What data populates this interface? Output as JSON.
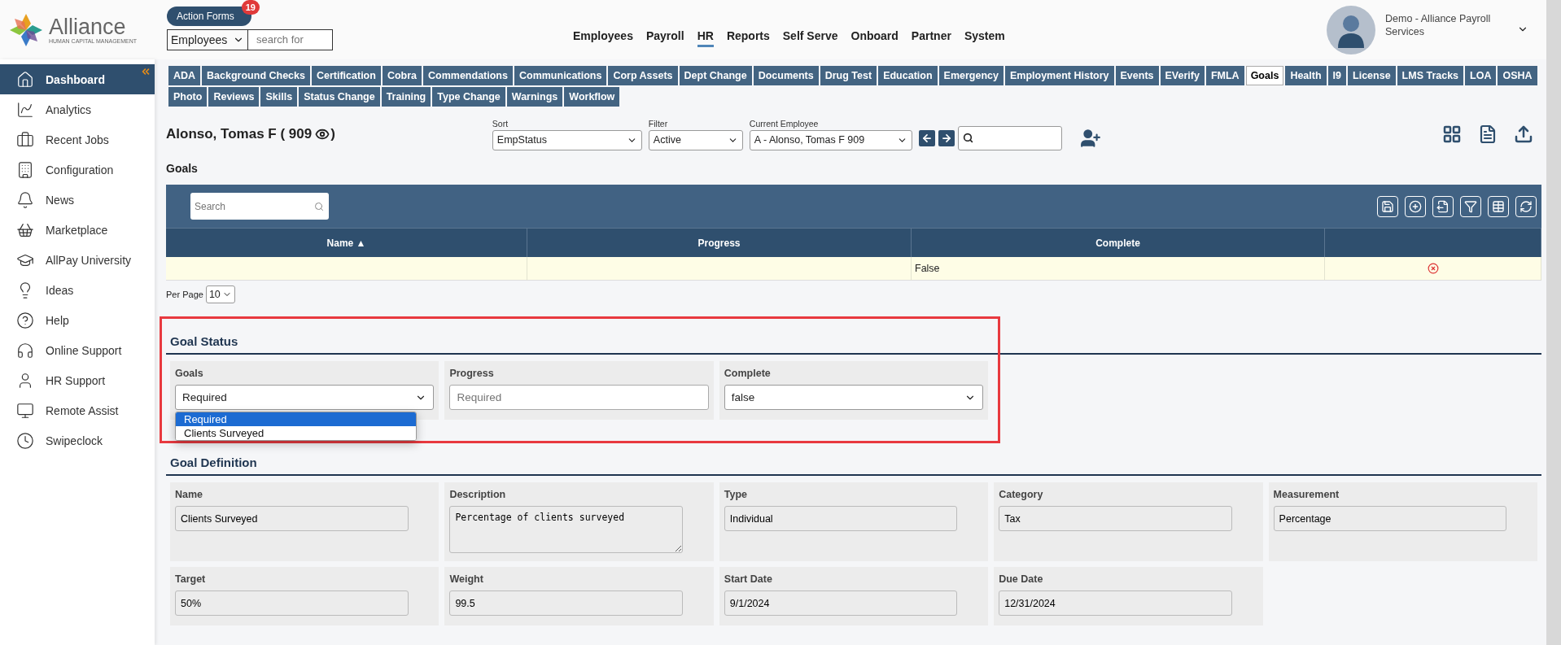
{
  "logo": {
    "name": "Alliance",
    "tagline": "HUMAN CAPITAL MANAGEMENT"
  },
  "action_forms": {
    "label": "Action Forms",
    "badge": "19"
  },
  "search_scope": {
    "value": "Employees"
  },
  "search": {
    "placeholder": "search for"
  },
  "main_nav": [
    {
      "label": "Employees",
      "selected": false
    },
    {
      "label": "Payroll",
      "selected": false
    },
    {
      "label": "HR",
      "selected": true
    },
    {
      "label": "Reports",
      "selected": false
    },
    {
      "label": "Self Serve",
      "selected": false
    },
    {
      "label": "Onboard",
      "selected": false
    },
    {
      "label": "Partner",
      "selected": false
    },
    {
      "label": "System",
      "selected": false
    }
  ],
  "user": {
    "name": "Demo - Alliance Payroll Services"
  },
  "sidebar": {
    "items": [
      {
        "label": "Dashboard",
        "selected": true
      },
      {
        "label": "Analytics",
        "selected": false
      },
      {
        "label": "Recent Jobs",
        "selected": false
      },
      {
        "label": "Configuration",
        "selected": false
      },
      {
        "label": "News",
        "selected": false
      },
      {
        "label": "Marketplace",
        "selected": false
      },
      {
        "label": "AllPay University",
        "selected": false
      },
      {
        "label": "Ideas",
        "selected": false
      },
      {
        "label": "Help",
        "selected": false
      },
      {
        "label": "Online Support",
        "selected": false
      },
      {
        "label": "HR Support",
        "selected": false
      },
      {
        "label": "Remote Assist",
        "selected": false
      },
      {
        "label": "Swipeclock",
        "selected": false
      }
    ]
  },
  "tab_rows": [
    [
      {
        "label": "ADA",
        "selected": false
      },
      {
        "label": "Background Checks",
        "selected": false
      },
      {
        "label": "Certification",
        "selected": false
      },
      {
        "label": "Cobra",
        "selected": false
      },
      {
        "label": "Commendations",
        "selected": false
      },
      {
        "label": "Communications",
        "selected": false
      },
      {
        "label": "Corp Assets",
        "selected": false
      },
      {
        "label": "Dept Change",
        "selected": false
      },
      {
        "label": "Documents",
        "selected": false
      },
      {
        "label": "Drug Test",
        "selected": false
      },
      {
        "label": "Education",
        "selected": false
      },
      {
        "label": "Emergency",
        "selected": false
      },
      {
        "label": "Employment History",
        "selected": false
      },
      {
        "label": "Events",
        "selected": false
      },
      {
        "label": "EVerify",
        "selected": false
      },
      {
        "label": "FMLA",
        "selected": false
      },
      {
        "label": "Goals",
        "selected": true
      },
      {
        "label": "Health",
        "selected": false
      },
      {
        "label": "I9",
        "selected": false
      },
      {
        "label": "License",
        "selected": false
      },
      {
        "label": "LMS Tracks",
        "selected": false
      },
      {
        "label": "LOA",
        "selected": false
      },
      {
        "label": "OSHA",
        "selected": false
      }
    ],
    [
      {
        "label": "Photo",
        "selected": false
      },
      {
        "label": "Reviews",
        "selected": false
      },
      {
        "label": "Skills",
        "selected": false
      },
      {
        "label": "Status Change",
        "selected": false
      },
      {
        "label": "Training",
        "selected": false
      },
      {
        "label": "Type Change",
        "selected": false
      },
      {
        "label": "Warnings",
        "selected": false
      },
      {
        "label": "Workflow",
        "selected": false
      }
    ]
  ],
  "employee": {
    "title_start": "Alonso, Tomas F ( 909",
    "title_end": ")"
  },
  "sort": {
    "label": "Sort",
    "value": "EmpStatus"
  },
  "filter": {
    "label": "Filter",
    "value": "Active"
  },
  "current_employee": {
    "label": "Current Employee",
    "value": "A - Alonso, Tomas F 909"
  },
  "section_title": "Goals",
  "table": {
    "search": {
      "placeholder": "Search"
    },
    "columns": [
      {
        "label": "Name",
        "sort_mark": "▲"
      },
      {
        "label": "Progress"
      },
      {
        "label": "Complete"
      }
    ],
    "rows": [
      {
        "complete": "False"
      }
    ],
    "per_page": {
      "label": "Per Page",
      "value": "10"
    }
  },
  "goal_status": {
    "title": "Goal Status",
    "highlighted": true,
    "fields": [
      {
        "label": "Goals",
        "kind": "select",
        "value": "Required",
        "open": true,
        "options": [
          {
            "label": "Required",
            "selected": true
          },
          {
            "label": "Clients Surveyed",
            "selected": false
          }
        ]
      },
      {
        "label": "Progress",
        "kind": "input",
        "placeholder": "Required"
      },
      {
        "label": "Complete",
        "kind": "select",
        "value": "false"
      }
    ]
  },
  "goal_definition": {
    "title": "Goal Definition",
    "fields": [
      {
        "label": "Name",
        "kind": "input",
        "value": "Clients Surveyed"
      },
      {
        "label": "Description",
        "kind": "textarea",
        "value": "Percentage of clients surveyed"
      },
      {
        "label": "Type",
        "kind": "input",
        "value": "Individual"
      },
      {
        "label": "Category",
        "kind": "input",
        "value": "Tax"
      },
      {
        "label": "Measurement",
        "kind": "input",
        "value": "Percentage"
      },
      {
        "label": "Target",
        "kind": "input",
        "value": "50%"
      },
      {
        "label": "Weight",
        "kind": "input",
        "value": "99.5"
      },
      {
        "label": "Start Date",
        "kind": "input",
        "value": "9/1/2024"
      },
      {
        "label": "Due Date",
        "kind": "input",
        "value": "12/31/2024"
      }
    ]
  }
}
